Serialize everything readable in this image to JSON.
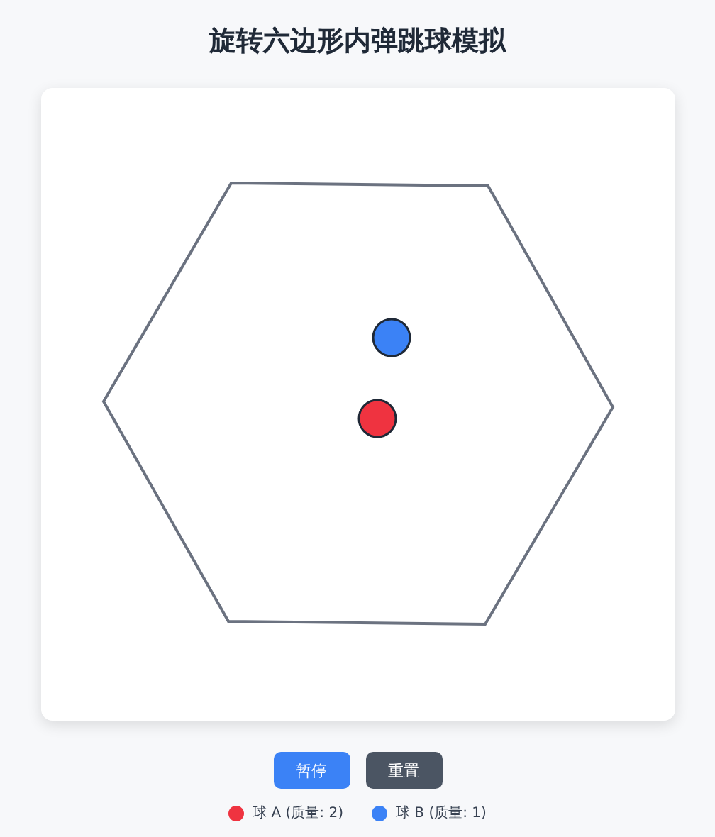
{
  "title": "旋转六边形内弹跳球模拟",
  "buttons": [
    {
      "label": "暂停",
      "kind": "primary"
    },
    {
      "label": "重置",
      "kind": "secondary"
    }
  ],
  "balls": [
    {
      "label": "球 A (质量: 2)",
      "color": "#ef3340"
    },
    {
      "label": "球 B (质量: 1)",
      "color": "#3b82f6"
    }
  ]
}
